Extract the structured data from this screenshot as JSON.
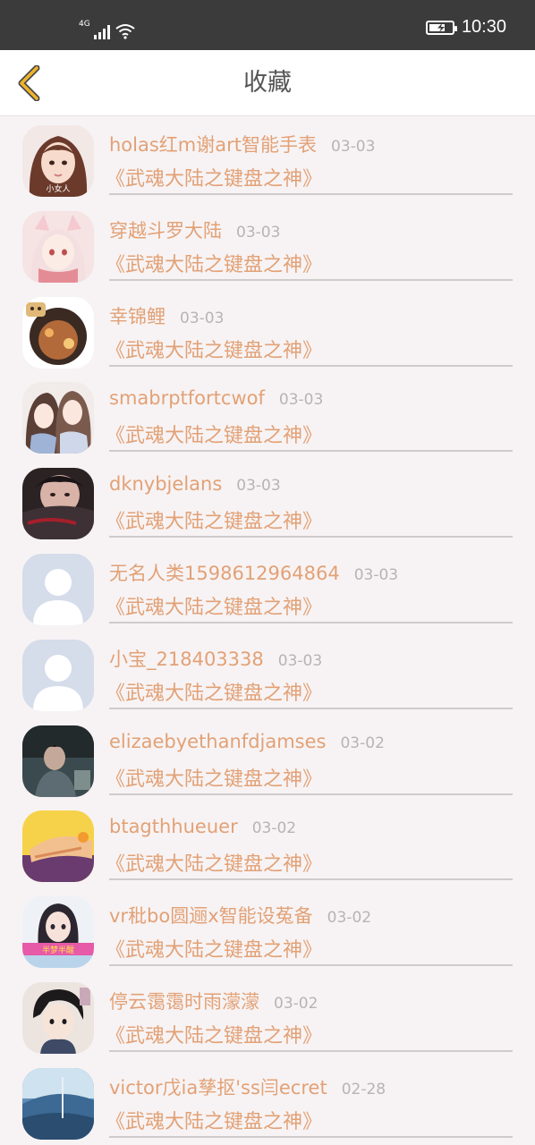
{
  "status_bar": {
    "network": "4G",
    "time": "10:30",
    "battery_level": 0.7
  },
  "nav": {
    "title": "收藏"
  },
  "favorites": [
    {
      "name": "holas红m谢art智能手表",
      "date": "03-03",
      "title": "《武魂大陆之键盘之神》",
      "avatar": "girl-portrait-avatar"
    },
    {
      "name": "穿越斗罗大陆",
      "date": "03-03",
      "title": "《武魂大陆之键盘之神》",
      "avatar": "anime-fox-girl-avatar"
    },
    {
      "name": "幸锦鲤",
      "date": "03-03",
      "title": "《武魂大陆之键盘之神》",
      "avatar": "bear-cafe-avatar"
    },
    {
      "name": "smabrptfortcwof",
      "date": "03-03",
      "title": "《武魂大陆之键盘之神》",
      "avatar": "anime-sisters-avatar"
    },
    {
      "name": "dknybjelans",
      "date": "03-03",
      "title": "《武魂大陆之键盘之神》",
      "avatar": "woman-sleeve-avatar"
    },
    {
      "name": "无名人类1598612964864",
      "date": "03-03",
      "title": "《武魂大陆之键盘之神》",
      "avatar": "default-person-avatar"
    },
    {
      "name": "小宝_218403338",
      "date": "03-03",
      "title": "《武魂大陆之键盘之神》",
      "avatar": "default-person-avatar"
    },
    {
      "name": "elizaebyethanfdjamses",
      "date": "03-02",
      "title": "《武魂大陆之键盘之神》",
      "avatar": "man-dark-room-avatar"
    },
    {
      "name": "btagthhueuer",
      "date": "03-02",
      "title": "《武魂大陆之键盘之神》",
      "avatar": "hand-yellow-avatar"
    },
    {
      "name": "vr秕bo圆逦x智能设菟备",
      "date": "03-02",
      "title": "《武魂大陆之键盘之神》",
      "avatar": "girl-banner-avatar"
    },
    {
      "name": "停云霭霭时雨濛濛",
      "date": "03-02",
      "title": "《武魂大陆之键盘之神》",
      "avatar": "anime-boy-avatar"
    },
    {
      "name": "victor戊ia孳抠'ss闫ecret",
      "date": "02-28",
      "title": "《武魂大陆之键盘之神》",
      "avatar": "blue-sky-avatar"
    }
  ]
}
